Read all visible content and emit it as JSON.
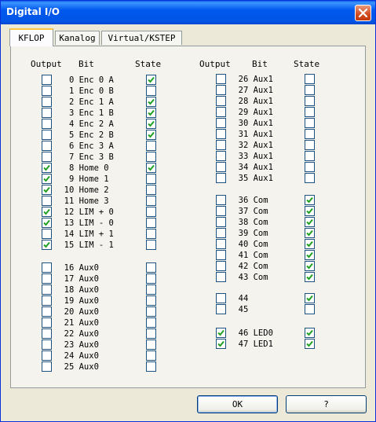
{
  "window": {
    "title": "Digital I/O"
  },
  "tabs": [
    {
      "label": "KFLOP",
      "active": true
    },
    {
      "label": "Kanalog",
      "active": false
    },
    {
      "label": "Virtual/KSTEP",
      "active": false
    }
  ],
  "headers": {
    "output": "Output",
    "bit": "Bit",
    "state": "State"
  },
  "bits": [
    {
      "bit": "0",
      "name": "Enc 0 A",
      "output": false,
      "state": true
    },
    {
      "bit": "1",
      "name": "Enc 0 B",
      "output": false,
      "state": false
    },
    {
      "bit": "2",
      "name": "Enc 1 A",
      "output": false,
      "state": true
    },
    {
      "bit": "3",
      "name": "Enc 1 B",
      "output": false,
      "state": true
    },
    {
      "bit": "4",
      "name": "Enc 2 A",
      "output": false,
      "state": true
    },
    {
      "bit": "5",
      "name": "Enc 2 B",
      "output": false,
      "state": true
    },
    {
      "bit": "6",
      "name": "Enc 3 A",
      "output": false,
      "state": false
    },
    {
      "bit": "7",
      "name": "Enc 3 B",
      "output": false,
      "state": false
    },
    {
      "bit": "8",
      "name": "Home 0",
      "output": true,
      "state": true
    },
    {
      "bit": "9",
      "name": "Home 1",
      "output": true,
      "state": false
    },
    {
      "bit": "10",
      "name": "Home 2",
      "output": true,
      "state": false
    },
    {
      "bit": "11",
      "name": "Home 3",
      "output": false,
      "state": false
    },
    {
      "bit": "12",
      "name": "LIM + 0",
      "output": true,
      "state": false
    },
    {
      "bit": "13",
      "name": "LIM - 0",
      "output": true,
      "state": false
    },
    {
      "bit": "14",
      "name": "LIM + 1",
      "output": false,
      "state": false
    },
    {
      "bit": "15",
      "name": "LIM - 1",
      "output": true,
      "state": false
    },
    {
      "bit": "16",
      "name": "Aux0",
      "output": false,
      "state": false
    },
    {
      "bit": "17",
      "name": "Aux0",
      "output": false,
      "state": false
    },
    {
      "bit": "18",
      "name": "Aux0",
      "output": false,
      "state": false
    },
    {
      "bit": "19",
      "name": "Aux0",
      "output": false,
      "state": false
    },
    {
      "bit": "20",
      "name": "Aux0",
      "output": false,
      "state": false
    },
    {
      "bit": "21",
      "name": "Aux0",
      "output": false,
      "state": false
    },
    {
      "bit": "22",
      "name": "Aux0",
      "output": false,
      "state": false
    },
    {
      "bit": "23",
      "name": "Aux0",
      "output": false,
      "state": false
    },
    {
      "bit": "24",
      "name": "Aux0",
      "output": false,
      "state": false
    },
    {
      "bit": "25",
      "name": "Aux0",
      "output": false,
      "state": false
    },
    {
      "bit": "26",
      "name": "Aux1",
      "output": false,
      "state": false
    },
    {
      "bit": "27",
      "name": "Aux1",
      "output": false,
      "state": false
    },
    {
      "bit": "28",
      "name": "Aux1",
      "output": false,
      "state": false
    },
    {
      "bit": "29",
      "name": "Aux1",
      "output": false,
      "state": false
    },
    {
      "bit": "30",
      "name": "Aux1",
      "output": false,
      "state": false
    },
    {
      "bit": "31",
      "name": "Aux1",
      "output": false,
      "state": false
    },
    {
      "bit": "32",
      "name": "Aux1",
      "output": false,
      "state": false
    },
    {
      "bit": "33",
      "name": "Aux1",
      "output": false,
      "state": false
    },
    {
      "bit": "34",
      "name": "Aux1",
      "output": false,
      "state": false
    },
    {
      "bit": "35",
      "name": "Aux1",
      "output": false,
      "state": false
    },
    {
      "bit": "36",
      "name": "Com",
      "output": false,
      "state": true
    },
    {
      "bit": "37",
      "name": "Com",
      "output": false,
      "state": true
    },
    {
      "bit": "38",
      "name": "Com",
      "output": false,
      "state": true
    },
    {
      "bit": "39",
      "name": "Com",
      "output": false,
      "state": true
    },
    {
      "bit": "40",
      "name": "Com",
      "output": false,
      "state": true
    },
    {
      "bit": "41",
      "name": "Com",
      "output": false,
      "state": true
    },
    {
      "bit": "42",
      "name": "Com",
      "output": false,
      "state": true
    },
    {
      "bit": "43",
      "name": "Com",
      "output": false,
      "state": true
    },
    {
      "bit": "44",
      "name": "",
      "output": false,
      "state": true
    },
    {
      "bit": "45",
      "name": "",
      "output": false,
      "state": false
    },
    {
      "bit": "46",
      "name": "LED0",
      "output": true,
      "state": true
    },
    {
      "bit": "47",
      "name": "LED1",
      "output": true,
      "state": true
    }
  ],
  "buttons": {
    "ok": "OK",
    "help": "?"
  },
  "colors": {
    "title_bar": "#0058EE",
    "check": "#21A121",
    "tab_highlight": "#FFC83C"
  }
}
